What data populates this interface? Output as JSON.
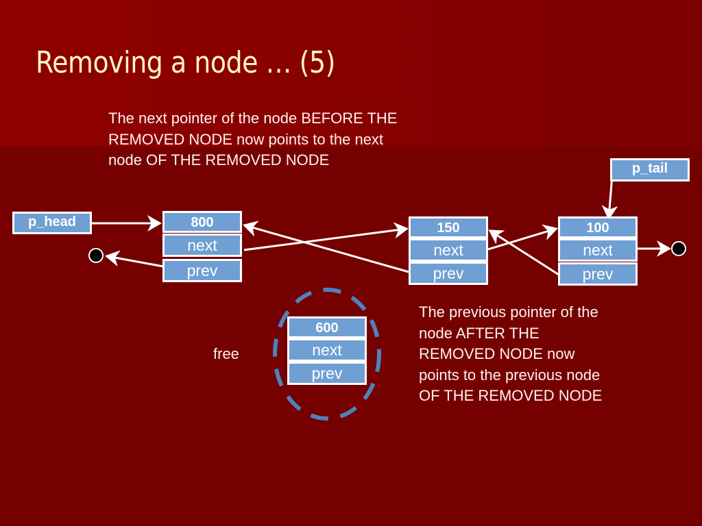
{
  "slide": {
    "title": "Removing a node … (5)",
    "note_before": "The next pointer of the node BEFORE THE REMOVED NODE now points to the next node OF THE REMOVED NODE",
    "note_after": "The previous pointer of the node AFTER THE REMOVED NODE now points to the previous node OF THE REMOVED NODE",
    "free_label": "free"
  },
  "pointers": {
    "head": "p_head",
    "tail": "p_tail"
  },
  "nodes": [
    {
      "address": "800",
      "next_label": "next",
      "prev_label": "prev"
    },
    {
      "address": "150",
      "next_label": "next",
      "prev_label": "prev"
    },
    {
      "address": "100",
      "next_label": "next",
      "prev_label": "prev"
    },
    {
      "address": "600",
      "next_label": "next",
      "prev_label": "prev",
      "state": "freed"
    }
  ],
  "colors": {
    "node_fill": "#6f9fd3",
    "free_circle": "#4f81bd",
    "title_text": "#fff5c8",
    "background": "#750000"
  }
}
